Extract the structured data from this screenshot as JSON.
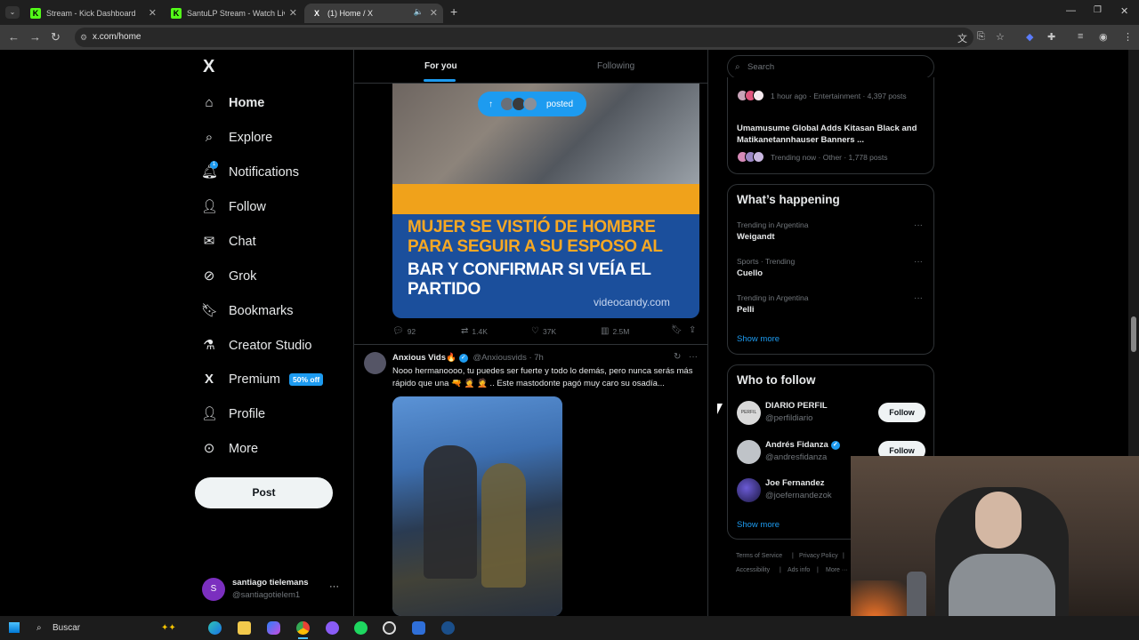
{
  "browser": {
    "tabs": [
      {
        "label": "Stream - Kick Dashboard",
        "fav": "K"
      },
      {
        "label": "SantuLP Stream - Watch Live on Kick",
        "fav": "K"
      },
      {
        "label": "(1) Home / X",
        "fav": "X"
      }
    ],
    "new_tab": "+",
    "url": "x.com/home"
  },
  "sidebar": {
    "logo": "X",
    "items": [
      {
        "label": "Home",
        "icon": "home-icon"
      },
      {
        "label": "Explore",
        "icon": "search-icon"
      },
      {
        "label": "Notifications",
        "icon": "bell-icon"
      },
      {
        "label": "Follow",
        "icon": "person-plus-icon"
      },
      {
        "label": "Chat",
        "icon": "mail-icon"
      },
      {
        "label": "Grok",
        "icon": "grok-icon"
      },
      {
        "label": "Bookmarks",
        "icon": "bookmark-icon"
      },
      {
        "label": "Creator Studio",
        "icon": "flask-icon"
      },
      {
        "label": "Premium",
        "icon": "x-icon"
      },
      {
        "label": "Profile",
        "icon": "person-icon"
      },
      {
        "label": "More",
        "icon": "more-circle-icon"
      }
    ],
    "notif_count": "1",
    "premium_badge": "50% off",
    "post_label": "Post",
    "account": {
      "name": "santiago tielemans",
      "handle": "@santiagotielem1",
      "initial": "S"
    }
  },
  "feed": {
    "tabs": {
      "for_you": "For you",
      "following": "Following"
    },
    "posted_label": "posted",
    "tweet1": {
      "headline_orange": "MUJER SE VISTIÓ DE HOMBRE PARA SEGUIR A SU ESPOSO AL",
      "headline_white": "BAR Y CONFIRMAR SI VEÍA EL PARTIDO",
      "watermark": "videocandy.com",
      "replies": "92",
      "reposts": "1.4K",
      "likes": "37K",
      "views": "2.5M"
    },
    "tweet2": {
      "name": "Anxious Vids🔥",
      "handle": "@Anxiousvids",
      "time": "· 7h",
      "text": "Nooo hermanoooo, tu puedes ser fuerte y todo lo demás, pero nunca serás más rápido que una 🔫 🤦 🤦 .. Este mastodonte pagó muy caro su osadía..."
    }
  },
  "right": {
    "search_placeholder": "Search",
    "top_card": {
      "meta1": "1 hour ago · Entertainment · 4,397 posts",
      "title2": "Umamusume Global Adds Kitasan Black and Matikanetannhauser Banners ...",
      "meta2": "Trending now · Other · 1,778 posts"
    },
    "happening": {
      "title": "What’s happening",
      "trends": [
        {
          "context": "Trending in Argentina",
          "name": "Weigandt"
        },
        {
          "context": "Sports · Trending",
          "name": "Cuello"
        },
        {
          "context": "Trending in Argentina",
          "name": "Pelli"
        }
      ],
      "show_more": "Show more"
    },
    "who_to_follow": {
      "title": "Who to follow",
      "users": [
        {
          "name": "DIARIO PERFIL",
          "handle": "@perfildiario",
          "button": "Follow"
        },
        {
          "name": "Andrés Fidanza",
          "handle": "@andresfidanza",
          "button": "Follow"
        },
        {
          "name": "Joe Fernandez",
          "handle": "@joefernandezok",
          "button": ""
        }
      ],
      "show_more": "Show more"
    },
    "footer": {
      "tos": "Terms of Service",
      "privacy": "Privacy Policy",
      "access": "Accessibility",
      "ads": "Ads info",
      "more": "More ···"
    }
  },
  "taskbar": {
    "search_label": "Buscar"
  }
}
